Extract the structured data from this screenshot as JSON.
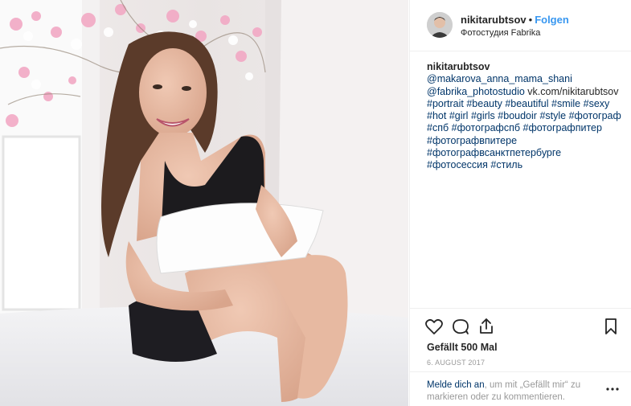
{
  "post": {
    "photo_alt": "",
    "user": {
      "username": "nikitarubtsov",
      "separator": "•",
      "follow_label": "Folgen",
      "location": "Фотостудия Fabrika"
    },
    "caption": {
      "username": "nikitarubtsov",
      "parts": [
        {
          "text": "@makarova_anna_mama_shani",
          "link": true
        },
        {
          "text": "@fabrika_photostudio",
          "link": true
        },
        {
          "text": "vk.com/nikitarubtsov",
          "link": false
        },
        {
          "text": "#portrait",
          "link": true
        },
        {
          "text": "#beauty",
          "link": true
        },
        {
          "text": "#beautiful",
          "link": true
        },
        {
          "text": "#smile",
          "link": true
        },
        {
          "text": "#sexy",
          "link": true
        },
        {
          "text": "#hot",
          "link": true
        },
        {
          "text": "#girl",
          "link": true
        },
        {
          "text": "#girls",
          "link": true
        },
        {
          "text": "#boudoir",
          "link": true
        },
        {
          "text": "#style",
          "link": true
        },
        {
          "text": "#фотограф",
          "link": true
        },
        {
          "text": "#спб",
          "link": true
        },
        {
          "text": "#фотографспб",
          "link": true
        },
        {
          "text": "#фотографпитер",
          "link": true
        },
        {
          "text": "#фотографвпитере",
          "link": true
        },
        {
          "text": "#фотографвсанктпетербурге",
          "link": true
        },
        {
          "text": "#фотосессия",
          "link": true
        },
        {
          "text": "#стиль",
          "link": true
        }
      ]
    },
    "actions": {
      "like_icon": "heart-icon",
      "comment_icon": "comment-icon",
      "share_icon": "share-icon",
      "save_icon": "bookmark-icon"
    },
    "likes_text": "Gefällt 500 Mal",
    "date_text": "6. AUGUST 2017",
    "login_prompt": {
      "link_text": "Melde dich an",
      "rest_text": ", um mit „Gefällt mir“ zu markieren oder zu kommentieren."
    },
    "more_icon": "more-options-icon"
  },
  "colors": {
    "link": "#003569",
    "accent": "#3897f0",
    "muted": "#999999",
    "text": "#262626"
  }
}
